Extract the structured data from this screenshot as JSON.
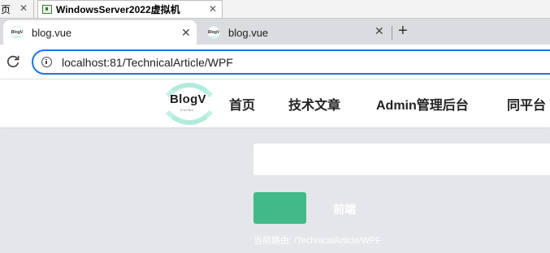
{
  "vm_window": {
    "prev_tab_label": "页",
    "active_tab_label": "WindowsServer2022虚拟机",
    "close_glyph": "✕"
  },
  "browser": {
    "tabs": [
      {
        "label": "blog.vue",
        "active": true
      },
      {
        "label": "blog.vue",
        "active": false
      }
    ],
    "favicon_text": "BlogV",
    "close_glyph": "✕",
    "new_tab_glyph": "+",
    "address": "localhost:81/TechnicalArticle/WPF"
  },
  "site": {
    "logo": {
      "title": "BlogV",
      "subtitle": "VUINC"
    },
    "nav": [
      "首页",
      "技术文章",
      "Admin管理后台",
      "同平台"
    ],
    "search_value": "",
    "button_label": "",
    "secondary_link": "前端",
    "route_text": "当前路由: /TechnicalArticle/WPF"
  },
  "colors": {
    "accent": "#1a73e8",
    "brand_green": "#42ba87",
    "logo_mint": "#8fe3cc",
    "page_bg": "#e5e6ea"
  },
  "icons": [
    "window-icon",
    "favicon-icon",
    "close-icon",
    "new-tab-icon",
    "reload-icon",
    "info-icon",
    "logo-icon"
  ]
}
